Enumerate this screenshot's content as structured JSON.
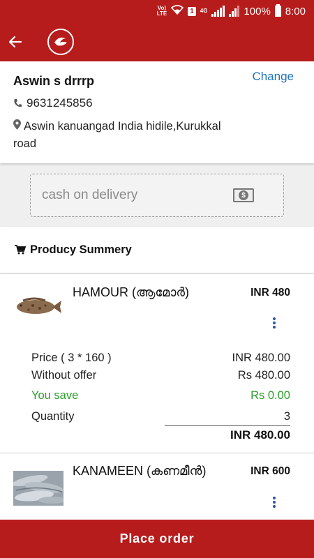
{
  "status_bar": {
    "volte": "Vo)\nLTE",
    "sim_badge": "1",
    "network": "4G",
    "battery": "100%",
    "time": "8:00"
  },
  "app_bar": {
    "back_icon": "arrow-left-icon",
    "logo_icon": "fish-logo-icon"
  },
  "address": {
    "name": "Aswin s drrrp",
    "change_label": "Change",
    "phone": "9631245856",
    "address_line": "Aswin kanuangad India hidile,Kurukkal road"
  },
  "payment": {
    "method": "cash on delivery",
    "icon": "cash-icon"
  },
  "summary": {
    "title": "Producy Summery",
    "icon": "cart-icon"
  },
  "products": [
    {
      "name": "HAMOUR (ആമോർ)",
      "price": "INR 480",
      "price_label": "Price ( 3 * 160 )",
      "price_value": "INR 480.00",
      "without_offer_label": "Without offer",
      "without_offer_value": "Rs 480.00",
      "you_save_label": "You save",
      "you_save_value": "Rs 0.00",
      "quantity_label": "Quantity",
      "quantity_value": "3",
      "total": "INR 480.00"
    },
    {
      "name": "KANAMEEN (കണമീൻ)",
      "price": "INR 600"
    }
  ],
  "colors": {
    "primary": "#b71c1c",
    "link": "#1e73be",
    "save_green": "#2a9d2a",
    "menu_dots": "#2f55a4"
  },
  "footer": {
    "place_order_label": "Place order"
  }
}
